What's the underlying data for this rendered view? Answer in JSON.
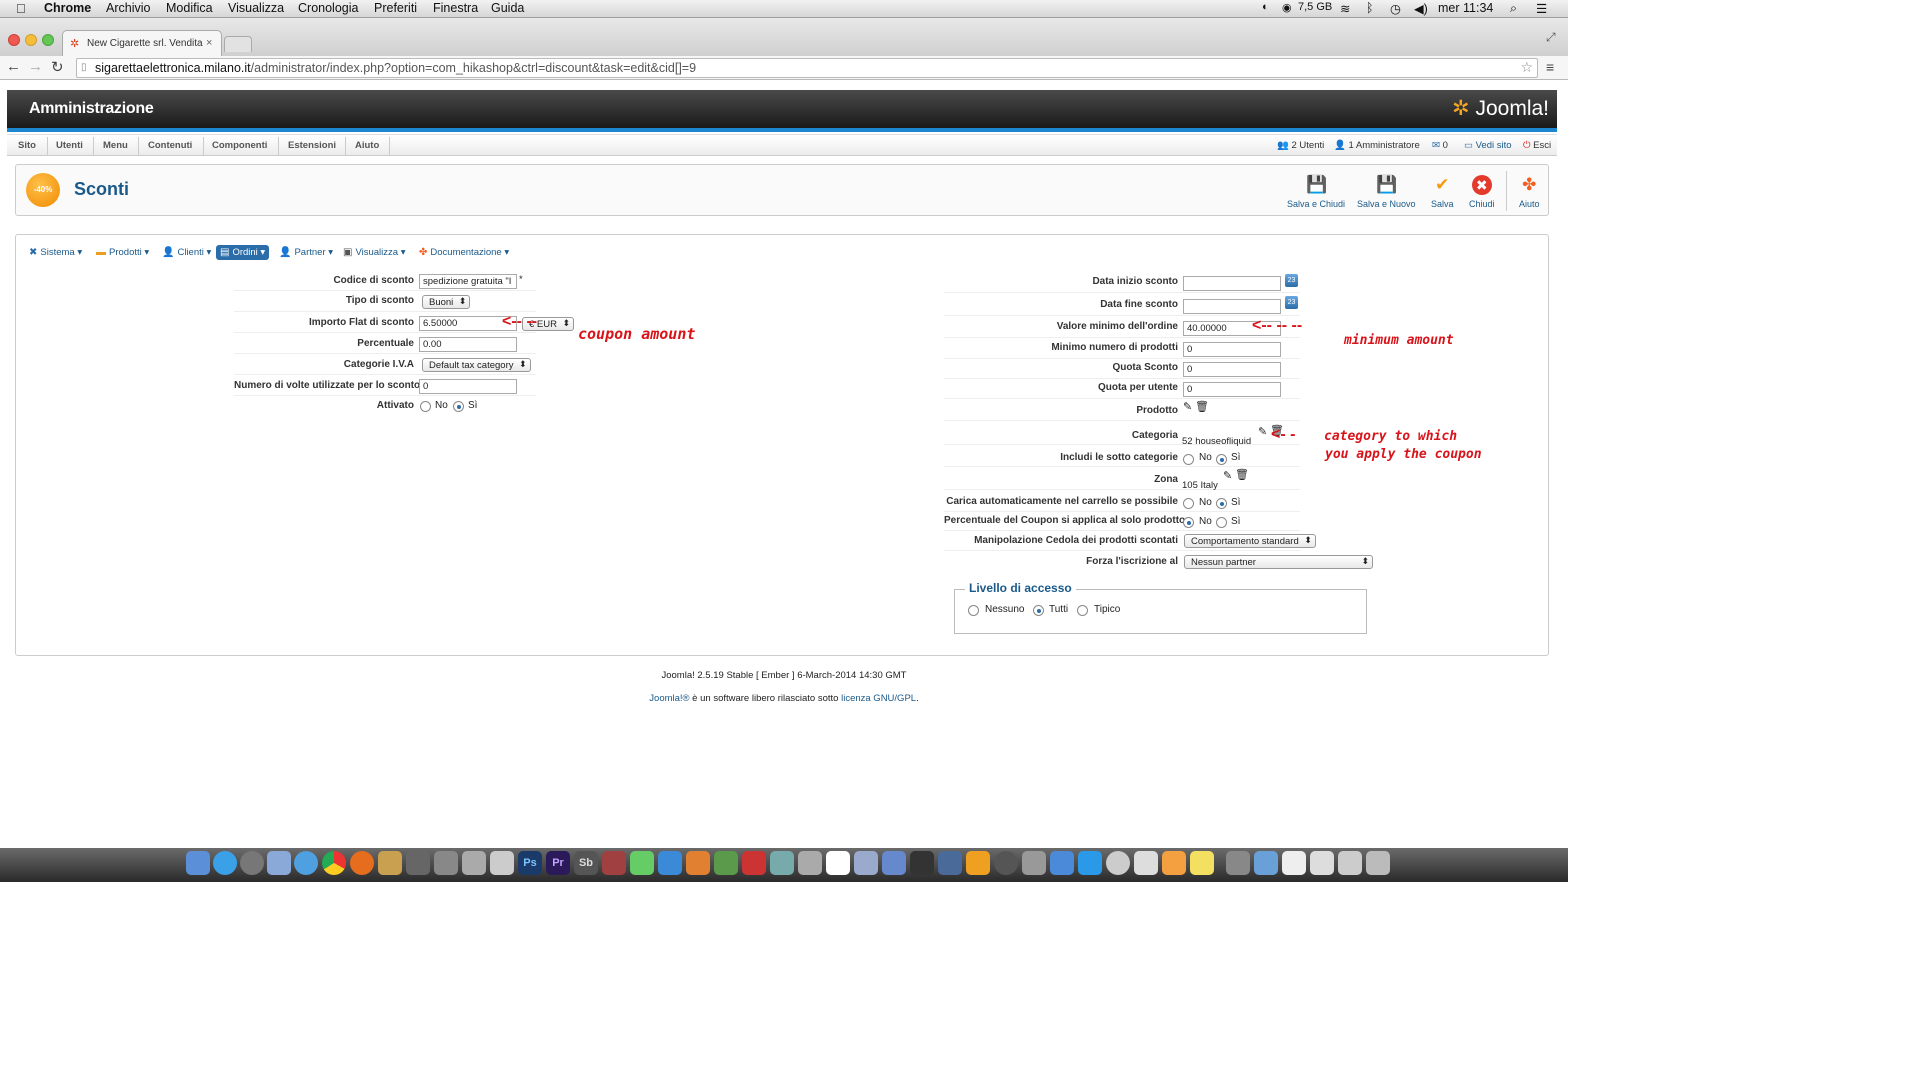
{
  "menubar": {
    "app": "Chrome",
    "items": [
      "Archivio",
      "Modifica",
      "Visualizza",
      "Cronologia",
      "Preferiti",
      "Finestra",
      "Guida"
    ],
    "memory": "7,5 GB",
    "clock": "mer 11:34"
  },
  "browser": {
    "tab_title": "New Cigarette srl. Vendita",
    "url_domain": "sigarettaelettronica.milano.it",
    "url_path": "/administrator/index.php?option=com_hikashop&ctrl=discount&task=edit&cid[]=9"
  },
  "header": {
    "title": "Amministrazione",
    "logo": "Joomla!"
  },
  "topmenu": {
    "items": [
      "Sito",
      "Utenti",
      "Menu",
      "Contenuti",
      "Componenti",
      "Estensioni",
      "Aiuto"
    ],
    "status": {
      "users": "2 Utenti",
      "admins": "1 Amministratore",
      "messages": "0",
      "view_site": "Vedi sito",
      "logout": "Esci"
    }
  },
  "page": {
    "title": "Sconti",
    "icon_text": "-40%"
  },
  "toolbar": {
    "save_close": "Salva e Chiudi",
    "save_new": "Salva e Nuovo",
    "save": "Salva",
    "close": "Chiudi",
    "help": "Aiuto"
  },
  "hikamenu": [
    "Sistema",
    "Prodotti",
    "Clienti",
    "Ordini",
    "Partner",
    "Visualizza",
    "Documentazione"
  ],
  "left_form": {
    "code_label": "Codice di sconto",
    "code_value": "spedizione gratuita \"I",
    "code_required": "*",
    "type_label": "Tipo di sconto",
    "type_value": "Buoni",
    "flat_label": "Importo Flat di sconto",
    "flat_value": "6.50000",
    "currency": "€ EUR",
    "percent_label": "Percentuale",
    "percent_value": "0.00",
    "tax_label": "Categorie I.V.A",
    "tax_value": "Default tax category",
    "uses_label": "Numero di volte utilizzate per lo sconto",
    "uses_value": "0",
    "active_label": "Attivato",
    "no": "No",
    "yes": "Sì"
  },
  "right_form": {
    "start_label": "Data inizio sconto",
    "end_label": "Data fine sconto",
    "cal_day": "23",
    "min_order_label": "Valore minimo dell'ordine",
    "min_order_value": "40.00000",
    "min_products_label": "Minimo numero di prodotti",
    "min_products_value": "0",
    "quota_label": "Quota Sconto",
    "quota_value": "0",
    "quota_user_label": "Quota per utente",
    "quota_user_value": "0",
    "product_label": "Prodotto",
    "category_label": "Categoria",
    "category_value": "52 houseofliquid",
    "subcat_label": "Includi le sotto categorie",
    "zone_label": "Zona",
    "zone_value": "105 Italy",
    "autoload_label": "Carica automaticamente nel carrello se possibile",
    "percent_only_label": "Percentuale del Coupon si applica al solo prodotto",
    "manip_label": "Manipolazione Cedola dei prodotti scontati",
    "manip_value": "Comportamento standard",
    "force_label": "Forza l'iscrizione al",
    "force_value": "Nessun partner",
    "no": "No",
    "yes": "Sì",
    "access_legend": "Livello di accesso",
    "access_none": "Nessuno",
    "access_all": "Tutti",
    "access_typical": "Tipico"
  },
  "annotations": {
    "coupon": "coupon amount",
    "minimum": "minimum amount",
    "category_1": "category to which",
    "category_2": "you apply the coupon"
  },
  "footer": {
    "version": "Joomla! 2.5.19 Stable [ Ember ] 6-March-2014 14:30 GMT",
    "brand": "Joomla!®",
    "text": " è un software libero rilasciato sotto ",
    "license": "licenza GNU/GPL",
    "end": "."
  }
}
